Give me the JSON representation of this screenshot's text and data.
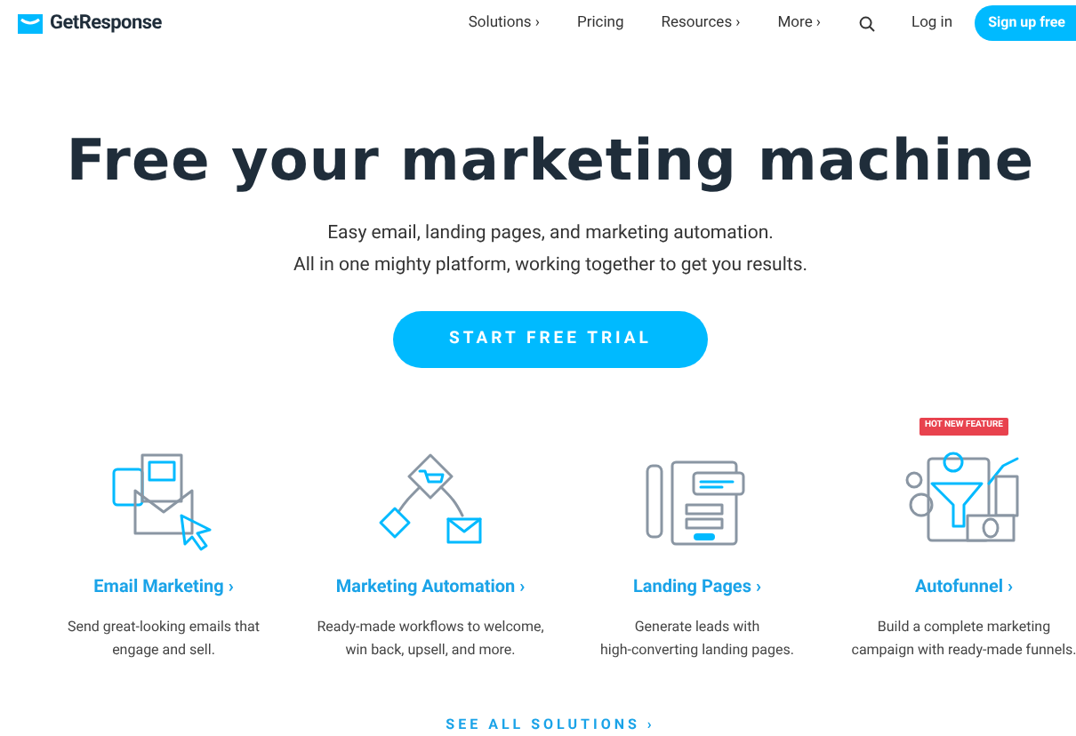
{
  "brand": "GetResponse",
  "nav": [
    {
      "label": "Solutions ›"
    },
    {
      "label": "Pricing"
    },
    {
      "label": "Resources ›"
    },
    {
      "label": "More ›"
    }
  ],
  "login": "Log in",
  "signup": "Sign up free",
  "hero": {
    "title": "Free your marketing machine",
    "subtitle": [
      "Easy email, landing pages, and marketing automation.",
      "All in one mighty platform, working together to get you results."
    ],
    "cta": "START FREE TRIAL"
  },
  "features": [
    {
      "kind": "email",
      "title": "Email Marketing ›",
      "description": [
        "Send great-looking emails that",
        "engage and sell."
      ]
    },
    {
      "kind": "automation",
      "title": "Marketing Automation ›",
      "description": [
        "Ready-made workflows to welcome,",
        "win back, upsell, and more."
      ]
    },
    {
      "kind": "landing",
      "title": "Landing Pages ›",
      "description": [
        "Generate leads with",
        "high-converting landing pages."
      ]
    },
    {
      "kind": "funnel",
      "badge": "HOT NEW FEATURE",
      "title": "Autofunnel ›",
      "description": [
        "Build a complete marketing",
        "campaign with ready-made funnels."
      ]
    }
  ],
  "see_all": "SEE ALL SOLUTIONS ›"
}
